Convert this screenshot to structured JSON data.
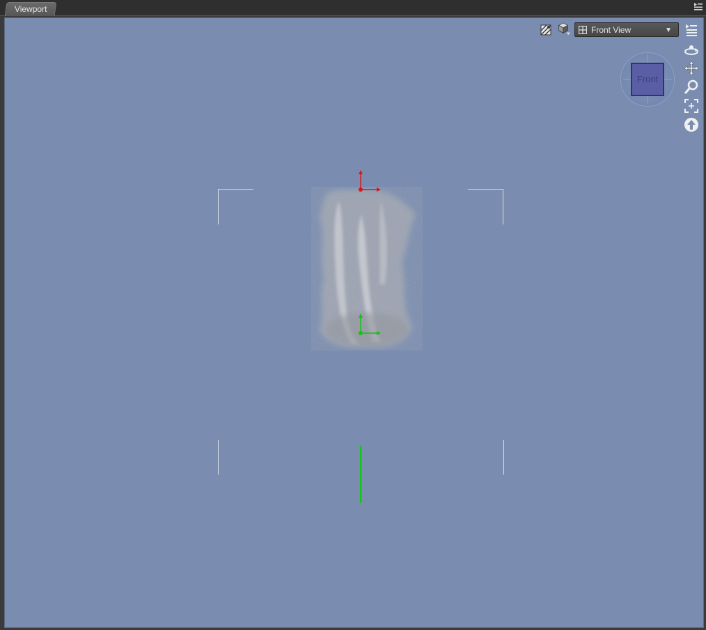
{
  "tabs": [
    {
      "label": "Viewport"
    }
  ],
  "viewport": {
    "view_select": {
      "value": "Front View"
    },
    "cube": {
      "face_label": "Front"
    },
    "colors": {
      "background": "#7a8db0",
      "x_axis": "#e01414",
      "y_axis": "#11c411"
    },
    "controls": {
      "left_icons": [
        "draw-style-icon",
        "viewport-shading-icon"
      ],
      "nav_icons": [
        "orbit-icon",
        "pan-icon",
        "zoom-icon",
        "frame-icon",
        "reset-view-icon"
      ]
    }
  }
}
